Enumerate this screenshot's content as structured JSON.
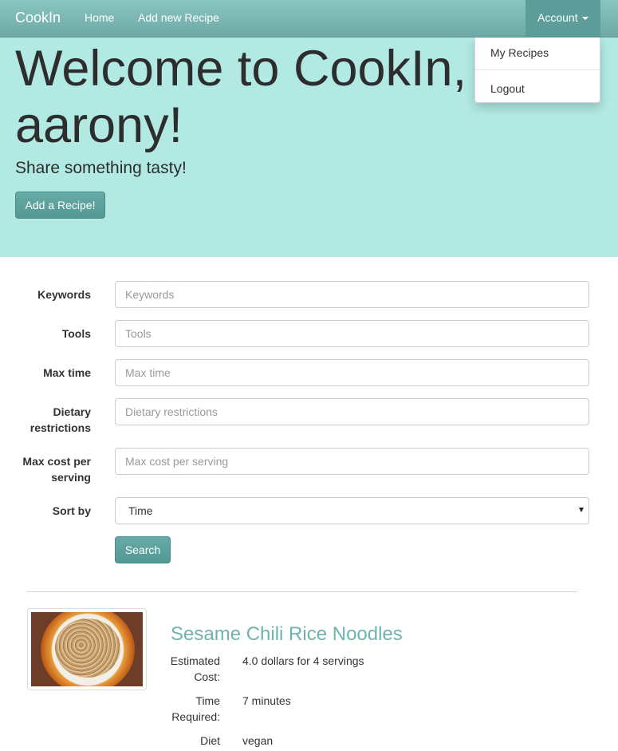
{
  "navbar": {
    "brand": "CookIn",
    "links": [
      "Home",
      "Add new Recipe"
    ],
    "account_label": "Account",
    "account_menu": [
      "My Recipes",
      "Logout"
    ]
  },
  "hero": {
    "title": "Welcome to CookIn, aarony!",
    "subtitle": "Share something tasty!",
    "button": "Add a Recipe!"
  },
  "search_form": {
    "fields": [
      {
        "label": "Keywords",
        "placeholder": "Keywords"
      },
      {
        "label": "Tools",
        "placeholder": "Tools"
      },
      {
        "label": "Max time",
        "placeholder": "Max time"
      },
      {
        "label": "Dietary restrictions",
        "placeholder": "Dietary restrictions"
      },
      {
        "label": "Max cost per serving",
        "placeholder": "Max cost per serving"
      }
    ],
    "sort": {
      "label": "Sort by",
      "value": "Time"
    },
    "submit": "Search"
  },
  "recipes": [
    {
      "title": "Sesame Chili Rice Noodles",
      "image_icon": "noodle-plate-image",
      "details": [
        {
          "label": "Estimated Cost:",
          "value": "4.0 dollars for 4 servings"
        },
        {
          "label": "Time Required:",
          "value": "7 minutes"
        },
        {
          "label": "Diet",
          "value": "vegan"
        }
      ]
    }
  ],
  "colors": {
    "navbar": "#7db8b5",
    "jumbotron": "#b2e9e3",
    "accent_button": "#5ea29e",
    "link": "#6fb3ae"
  }
}
